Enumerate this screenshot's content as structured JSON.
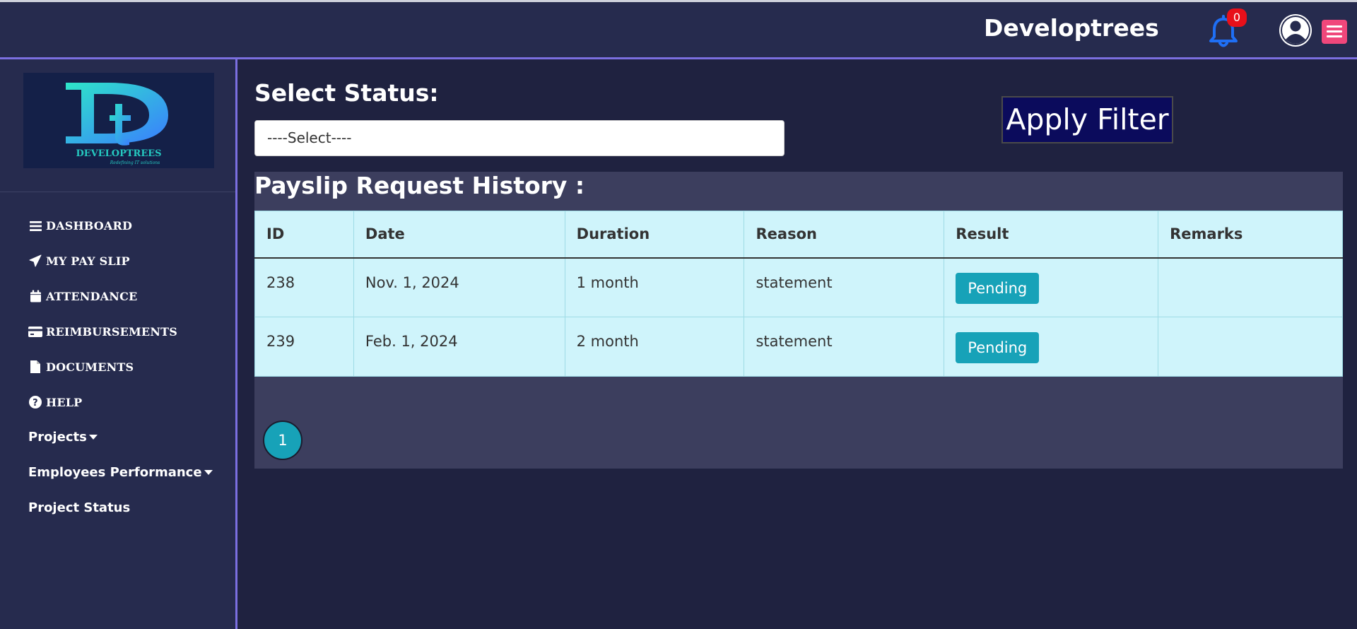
{
  "header": {
    "brand": "Developtrees",
    "notification_count": "0"
  },
  "sidebar": {
    "logo": {
      "text": "DEVELOPTREES",
      "tagline": "Redefining IT solutions"
    },
    "items": [
      {
        "label": "DASHBOARD",
        "icon": "bars-icon"
      },
      {
        "label": "MY PAY SLIP",
        "icon": "paper-plane-icon"
      },
      {
        "label": "ATTENDANCE",
        "icon": "calendar-icon"
      },
      {
        "label": "REIMBURSEMENTS",
        "icon": "credit-card-icon"
      },
      {
        "label": "DOCUMENTS",
        "icon": "file-icon"
      },
      {
        "label": "HELP",
        "icon": "question-circle-icon"
      },
      {
        "label": "Projects",
        "icon": "caret-down-icon"
      },
      {
        "label": "Employees Performance",
        "icon": "caret-down-icon"
      },
      {
        "label": "Project Status",
        "icon": ""
      }
    ]
  },
  "filter": {
    "label": "Select Status:",
    "selected": "----Select----",
    "apply_label": "Apply Filter"
  },
  "history": {
    "title": "Payslip Request History :",
    "columns": [
      "ID",
      "Date",
      "Duration",
      "Reason",
      "Result",
      "Remarks"
    ],
    "rows": [
      {
        "id": "238",
        "date": "Nov. 1, 2024",
        "duration": "1 month",
        "reason": "statement",
        "result": "Pending",
        "remarks": ""
      },
      {
        "id": "239",
        "date": "Feb. 1, 2024",
        "duration": "2 month",
        "reason": "statement",
        "result": "Pending",
        "remarks": ""
      }
    ],
    "pagination": {
      "current_page": "1"
    }
  },
  "colors": {
    "background": "#1f2240",
    "topbar": "#262b4e",
    "accent_border": "#7b6fe0",
    "table_bg": "#cff4fb",
    "pending": "#17a2b8",
    "apply_button": "#0b0b5c",
    "menu_button": "#f0477b",
    "badge": "#e8101a"
  }
}
